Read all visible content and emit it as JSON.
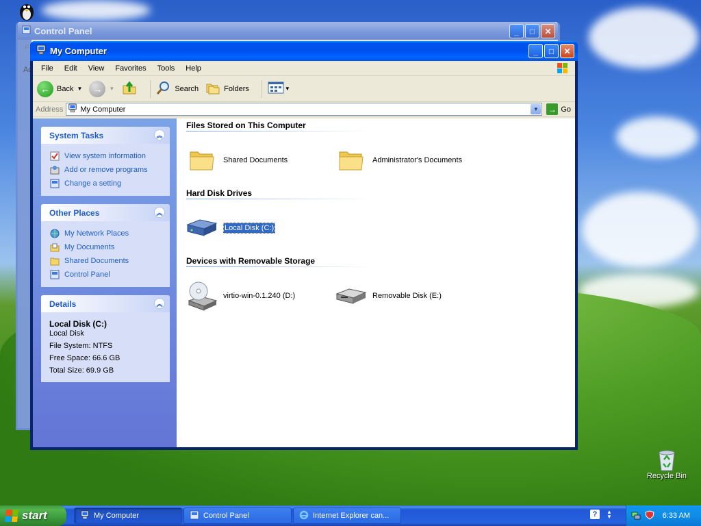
{
  "colors": {
    "link": "#215dc6",
    "selection": "#316ac5",
    "titlebar": "#0053ee"
  },
  "back_window": {
    "title": "Control Panel",
    "menu_first_letter": "F",
    "address_fragment": "Ad"
  },
  "window": {
    "title": "My Computer",
    "menu": [
      "File",
      "Edit",
      "View",
      "Favorites",
      "Tools",
      "Help"
    ],
    "toolbar": {
      "back": "Back",
      "search": "Search",
      "folders": "Folders"
    },
    "address": {
      "label": "Address",
      "value": "My Computer",
      "go": "Go"
    }
  },
  "left_pane": {
    "system_tasks": {
      "title": "System Tasks",
      "items": [
        {
          "label": "View system information",
          "icon": "system-info-icon"
        },
        {
          "label": "Add or remove programs",
          "icon": "add-remove-icon"
        },
        {
          "label": "Change a setting",
          "icon": "control-panel-icon"
        }
      ]
    },
    "other_places": {
      "title": "Other Places",
      "items": [
        {
          "label": "My Network Places",
          "icon": "network-places-icon"
        },
        {
          "label": "My Documents",
          "icon": "my-documents-icon"
        },
        {
          "label": "Shared Documents",
          "icon": "folder-icon"
        },
        {
          "label": "Control Panel",
          "icon": "control-panel-icon"
        }
      ]
    },
    "details": {
      "title": "Details",
      "name": "Local Disk (C:)",
      "type": "Local Disk",
      "file_system": "File System: NTFS",
      "free_space": "Free Space: 66.6 GB",
      "total_size": "Total Size: 69.9 GB"
    }
  },
  "content": {
    "groups": [
      {
        "title": "Files Stored on This Computer",
        "items": [
          {
            "label": "Shared Documents",
            "icon": "folder-icon"
          },
          {
            "label": "Administrator's Documents",
            "icon": "folder-icon"
          }
        ]
      },
      {
        "title": "Hard Disk Drives",
        "items": [
          {
            "label": "Local Disk (C:)",
            "icon": "hard-disk-icon",
            "selected": true
          }
        ]
      },
      {
        "title": "Devices with Removable Storage",
        "items": [
          {
            "label": "virtio-win-0.1.240 (D:)",
            "icon": "cd-drive-icon"
          },
          {
            "label": "Removable Disk (E:)",
            "icon": "removable-disk-icon"
          }
        ]
      }
    ]
  },
  "desktop": {
    "recycle_bin": "Recycle Bin"
  },
  "taskbar": {
    "start": "start",
    "tasks": [
      {
        "label": "My Computer",
        "active": true
      },
      {
        "label": "Control Panel",
        "active": false
      },
      {
        "label": "Internet Explorer can...",
        "active": false
      }
    ],
    "clock": "6:33 AM"
  }
}
